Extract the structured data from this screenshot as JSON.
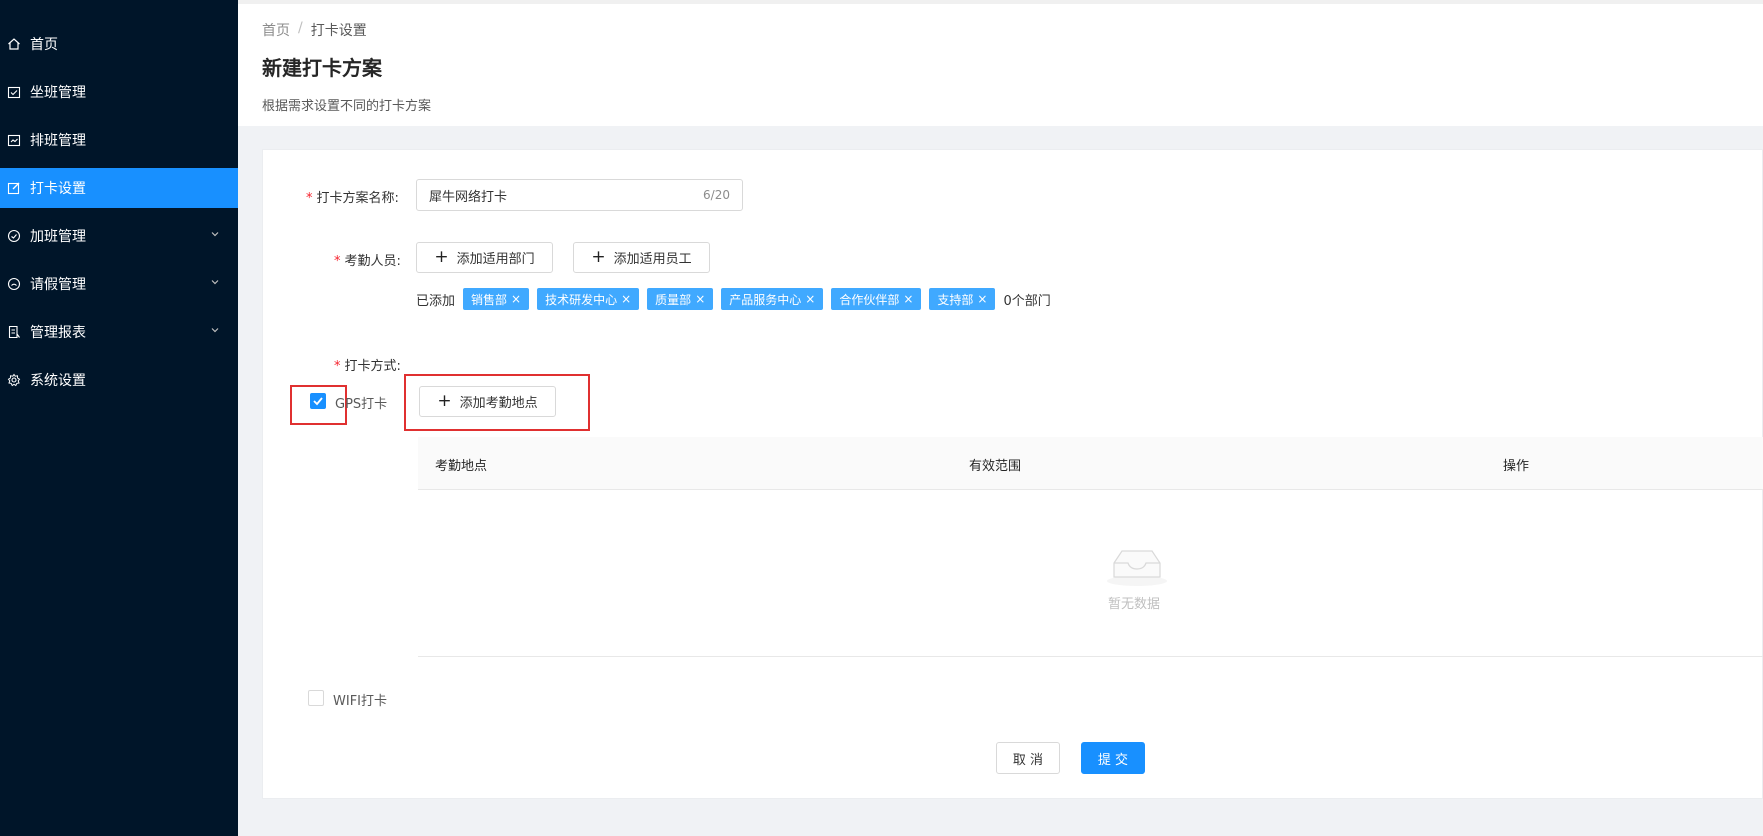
{
  "sidebar": {
    "items": [
      {
        "label": "首页",
        "icon": "home-icon",
        "active": false
      },
      {
        "label": "坐班管理",
        "icon": "calendar-check-icon",
        "active": false
      },
      {
        "label": "排班管理",
        "icon": "schedule-icon",
        "active": false
      },
      {
        "label": "打卡设置",
        "icon": "edit-icon",
        "active": true
      },
      {
        "label": "加班管理",
        "icon": "clock-icon",
        "active": false,
        "expandable": true
      },
      {
        "label": "请假管理",
        "icon": "smile-icon",
        "active": false,
        "expandable": true
      },
      {
        "label": "管理报表",
        "icon": "report-icon",
        "active": false,
        "expandable": true
      },
      {
        "label": "系统设置",
        "icon": "gear-icon",
        "active": false
      }
    ]
  },
  "breadcrumb": {
    "home": "首页",
    "sep": "/",
    "current": "打卡设置"
  },
  "header": {
    "title": "新建打卡方案",
    "description": "根据需求设置不同的打卡方案"
  },
  "form": {
    "name": {
      "required": "*",
      "label": "打卡方案名称:",
      "value": "犀牛网络打卡",
      "count": "6/20"
    },
    "staff": {
      "required": "*",
      "label": "考勤人员:",
      "add_department": "添加适用部门",
      "add_employee": "添加适用员工",
      "added_label": "已添加",
      "tags": [
        "销售部",
        "技术研发中心",
        "质量部",
        "产品服务中心",
        "合作伙伴部",
        "支持部"
      ],
      "tag_close": "×",
      "summary": "0个部门"
    },
    "method": {
      "required": "*",
      "label": "打卡方式:",
      "gps_label": "GPS打卡",
      "gps_checked": true,
      "add_location": "添加考勤地点",
      "wifi_label": "WIFI打卡",
      "wifi_checked": false
    },
    "table": {
      "columns": [
        "考勤地点",
        "有效范围",
        "操作"
      ],
      "empty_text": "暂无数据"
    },
    "actions": {
      "cancel": "取 消",
      "submit": "提 交"
    }
  },
  "colors": {
    "sidebar_bg": "#001529",
    "active": "#1890ff",
    "tag": "#40a9ff",
    "highlight": "#e03030"
  }
}
